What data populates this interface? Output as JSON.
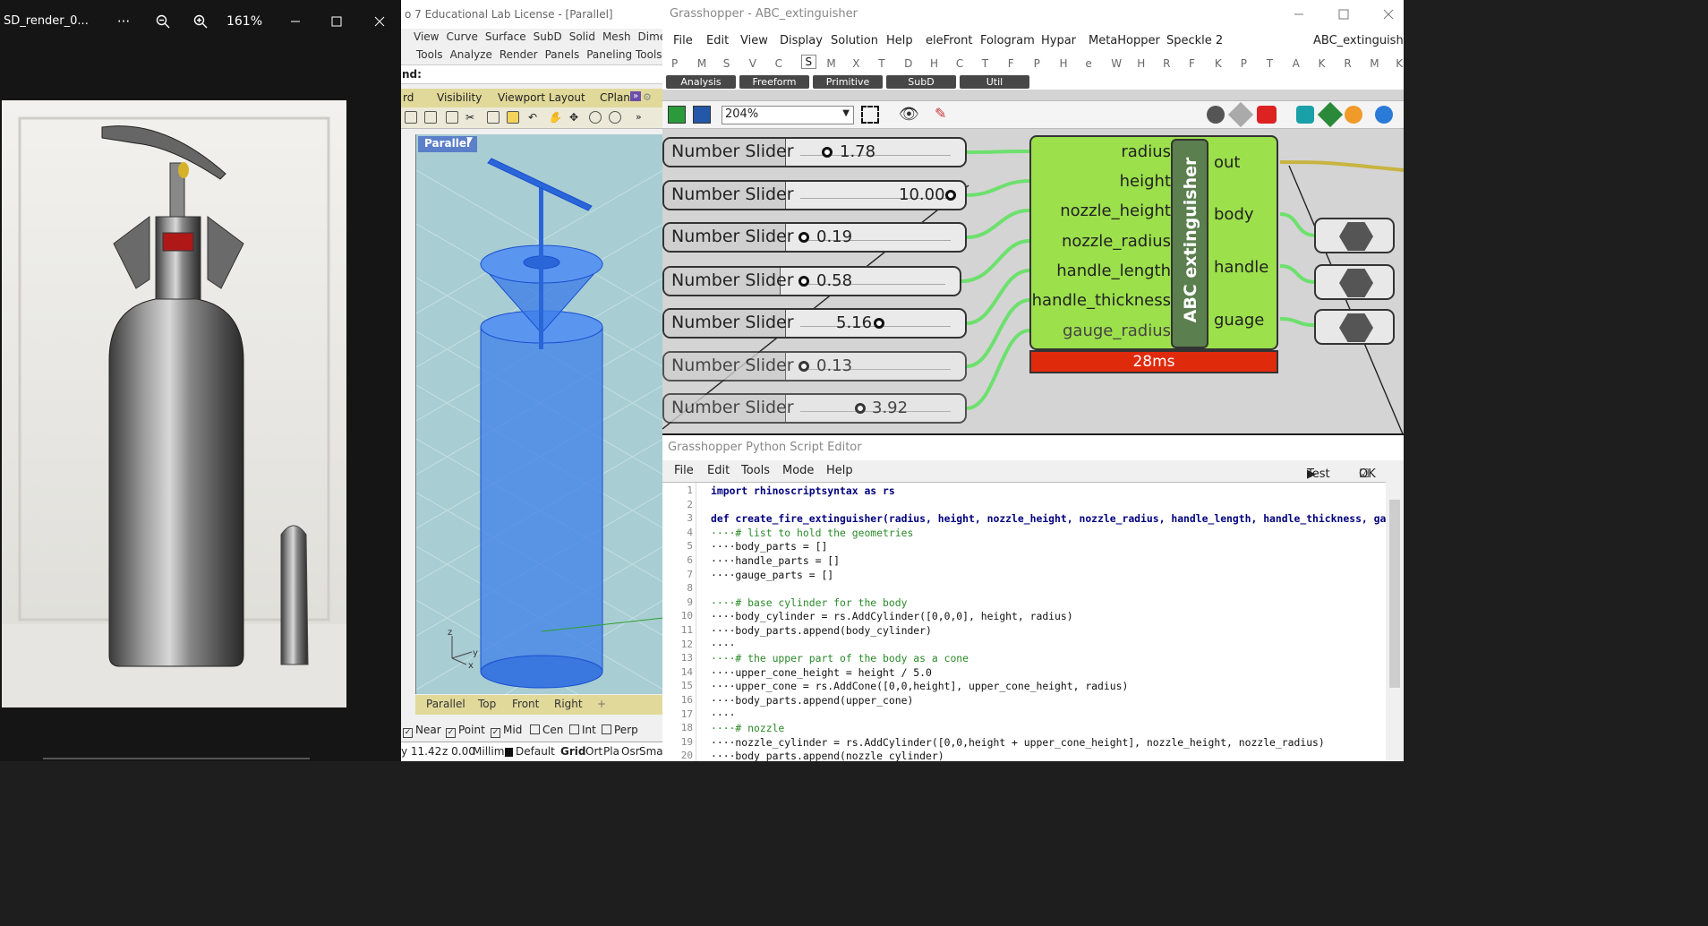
{
  "viewer": {
    "title": "SD_render_0...",
    "more": "···",
    "zoom": "161%"
  },
  "rhino": {
    "title": "o 7 Educational Lab License - [Parallel]",
    "menu1": [
      "View",
      "Curve",
      "Surface",
      "SubD",
      "Solid",
      "Mesh",
      "Dime"
    ],
    "menu2": [
      "Tools",
      "Analyze",
      "Render",
      "Panels",
      "Paneling Tools"
    ],
    "command": "nd:",
    "tabs": [
      "rd",
      "Visibility",
      "Viewport Layout",
      "CPlan"
    ],
    "viewport_label": "Parallel",
    "view_tabs": [
      "Parallel",
      "Top",
      "Front",
      "Right",
      "+"
    ],
    "osnaps": [
      {
        "label": "Near",
        "checked": true
      },
      {
        "label": "Point",
        "checked": true
      },
      {
        "label": "Mid",
        "checked": true
      },
      {
        "label": "Cen",
        "checked": false
      },
      {
        "label": "Int",
        "checked": false
      },
      {
        "label": "Perp",
        "checked": false
      }
    ],
    "status": [
      "y 11.42",
      "z 0.00",
      "Millim",
      "Default",
      "Grid",
      "Ort",
      "Pla",
      "Osr",
      "Sma"
    ]
  },
  "grasshopper": {
    "title": "Grasshopper - ABC_extinguisher",
    "menu": [
      "File",
      "Edit",
      "View",
      "Display",
      "Solution",
      "Help",
      "eleFront",
      "Fologram",
      "Hypar",
      "MetaHopper",
      "Speckle 2"
    ],
    "doc_name": "ABC_extinguisher",
    "tab_letters": [
      "P",
      "M",
      "S",
      "V",
      "C",
      "S",
      "M",
      "X",
      "T",
      "D",
      "H",
      "C",
      "T",
      "F",
      "P",
      "H",
      "e",
      "W",
      "H",
      "R",
      "F",
      "K",
      "P",
      "T",
      "A",
      "K",
      "R",
      "M",
      "K"
    ],
    "groups": [
      "Analysis",
      "Freeform",
      "Primitive",
      "SubD",
      "Util"
    ],
    "zoom": "204%",
    "sliders": [
      {
        "label": "Number Slider",
        "value": "1.78"
      },
      {
        "label": "Number Slider",
        "value": "10.00"
      },
      {
        "label": "Number Slider",
        "value": "0.19"
      },
      {
        "label": "Number Slider",
        "value": "0.58"
      },
      {
        "label": "Number Slider",
        "value": "5.16"
      },
      {
        "label": "Number Slider",
        "value": "0.13"
      },
      {
        "label": "Number Slider",
        "value": "3.92"
      }
    ],
    "component": {
      "name": "ABC extinguisher",
      "inputs": [
        "radius",
        "height",
        "nozzle_height",
        "nozzle_radius",
        "handle_length",
        "handle_thickness",
        "gauge_radius"
      ],
      "outputs": [
        "out",
        "body",
        "handle",
        "guage"
      ],
      "time": "28ms"
    }
  },
  "python_editor": {
    "title": "Grasshopper Python Script Editor",
    "menu": [
      "File",
      "Edit",
      "Tools",
      "Mode",
      "Help"
    ],
    "test": "Test",
    "ok": "OK",
    "lines": [
      "import rhinoscriptsyntax as rs",
      "",
      "def create_fire_extinguisher(radius, height, nozzle_height, nozzle_radius, handle_length, handle_thickness, gauge_r",
      "····# list to hold the geometries",
      "····body_parts = []",
      "····handle_parts = []",
      "····gauge_parts = []",
      "",
      "····# base cylinder for the body",
      "····body_cylinder = rs.AddCylinder([0,0,0], height, radius)",
      "····body_parts.append(body_cylinder)",
      "····",
      "····# the upper part of the body as a cone",
      "····upper_cone_height = height / 5.0",
      "····upper_cone = rs.AddCone([0,0,height], upper_cone_height, radius)",
      "····body_parts.append(upper_cone)",
      "····",
      "····# nozzle",
      "····nozzle_cylinder = rs.AddCylinder([0,0,height + upper_cone_height], nozzle_height, nozzle_radius)",
      "····body_parts.append(nozzle_cylinder)"
    ]
  }
}
